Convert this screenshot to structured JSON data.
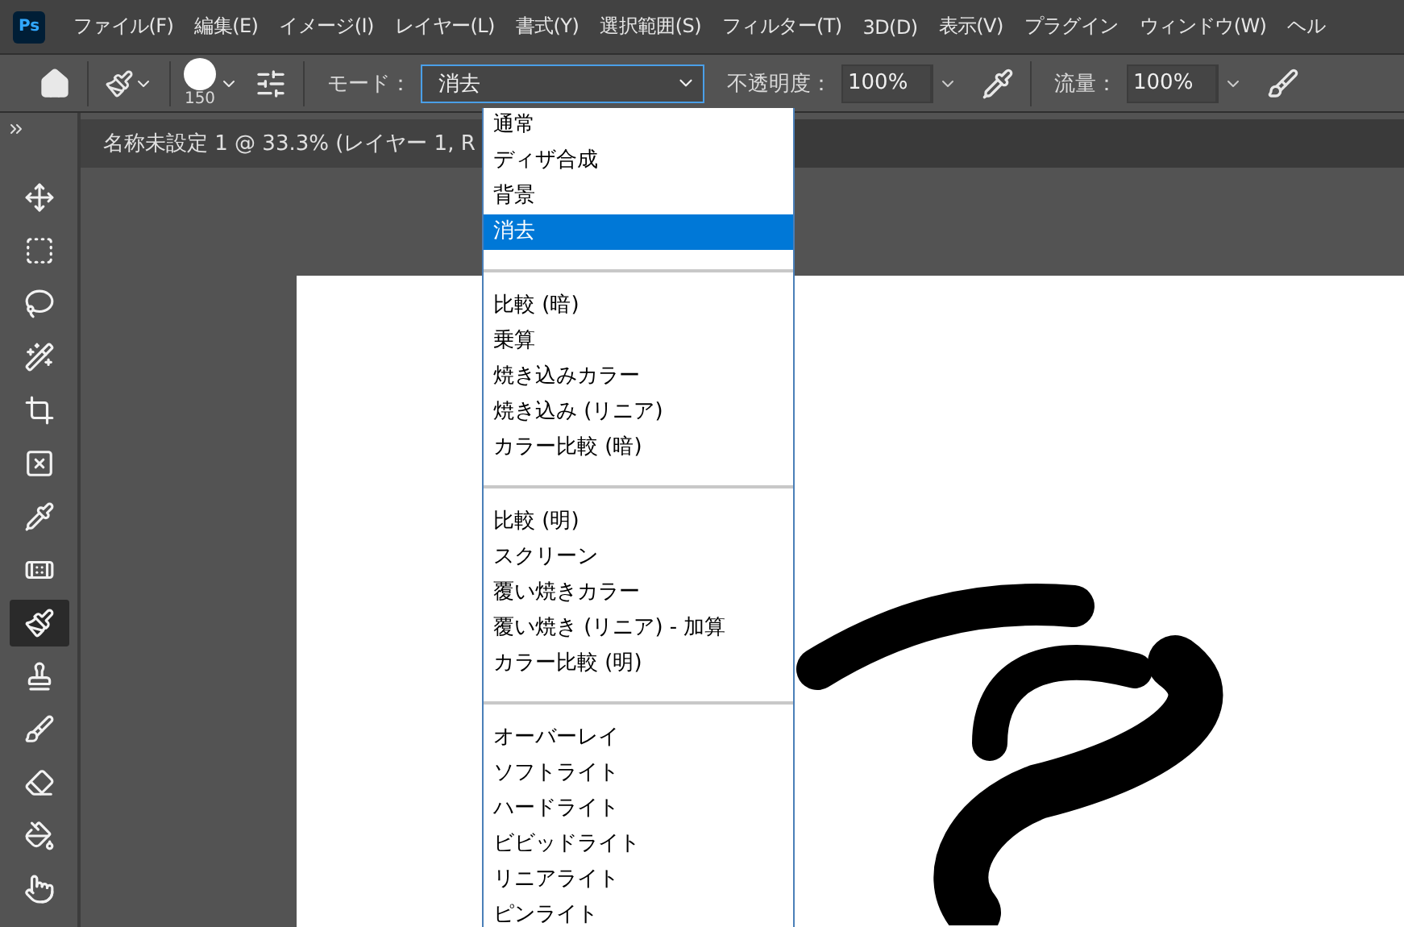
{
  "app_icon": {
    "label": "Ps"
  },
  "menu_bar": [
    "ファイル(F)",
    "編集(E)",
    "イメージ(I)",
    "レイヤー(L)",
    "書式(Y)",
    "選択範囲(S)",
    "フィルター(T)",
    "3D(D)",
    "表示(V)",
    "プラグイン",
    "ウィンドウ(W)",
    "ヘル"
  ],
  "options_bar": {
    "brush_size": "150",
    "mode_label": "モード：",
    "mode_value": "消去",
    "opacity_label": "不透明度：",
    "opacity_value": "100%",
    "flow_label": "流量：",
    "flow_value": "100%"
  },
  "document_tab": {
    "title": "名称未設定 1 @ 33.3% (レイヤー 1, R"
  },
  "tools": [
    {
      "kind": "move",
      "selected": false
    },
    {
      "kind": "marquee",
      "selected": false
    },
    {
      "kind": "lasso",
      "selected": false
    },
    {
      "kind": "wand",
      "selected": false
    },
    {
      "kind": "crop",
      "selected": false
    },
    {
      "kind": "frame",
      "selected": false
    },
    {
      "kind": "eyedropper",
      "selected": false
    },
    {
      "kind": "patch",
      "selected": false
    },
    {
      "kind": "brush",
      "selected": true
    },
    {
      "kind": "stamp",
      "selected": false
    },
    {
      "kind": "history",
      "selected": false
    },
    {
      "kind": "eraser",
      "selected": false
    },
    {
      "kind": "bucket",
      "selected": false
    },
    {
      "kind": "smudge",
      "selected": false
    }
  ],
  "mode_dropdown": {
    "groups": [
      {
        "items": [
          {
            "label": "通常",
            "selected": false
          },
          {
            "label": "ディザ合成",
            "selected": false
          },
          {
            "label": "背景",
            "selected": false
          },
          {
            "label": "消去",
            "selected": true
          }
        ]
      },
      {
        "items": [
          {
            "label": "比較 (暗)",
            "selected": false
          },
          {
            "label": "乗算",
            "selected": false
          },
          {
            "label": "焼き込みカラー",
            "selected": false
          },
          {
            "label": "焼き込み (リニア)",
            "selected": false
          },
          {
            "label": "カラー比較 (暗)",
            "selected": false
          }
        ]
      },
      {
        "items": [
          {
            "label": "比較 (明)",
            "selected": false
          },
          {
            "label": "スクリーン",
            "selected": false
          },
          {
            "label": "覆い焼きカラー",
            "selected": false
          },
          {
            "label": "覆い焼き (リニア) - 加算",
            "selected": false
          },
          {
            "label": "カラー比較 (明)",
            "selected": false
          }
        ]
      },
      {
        "items": [
          {
            "label": "オーバーレイ",
            "selected": false
          },
          {
            "label": "ソフトライト",
            "selected": false
          },
          {
            "label": "ハードライト",
            "selected": false
          },
          {
            "label": "ビビッドライト",
            "selected": false
          },
          {
            "label": "リニアライト",
            "selected": false
          },
          {
            "label": "ピンライト",
            "selected": false
          }
        ]
      }
    ]
  }
}
